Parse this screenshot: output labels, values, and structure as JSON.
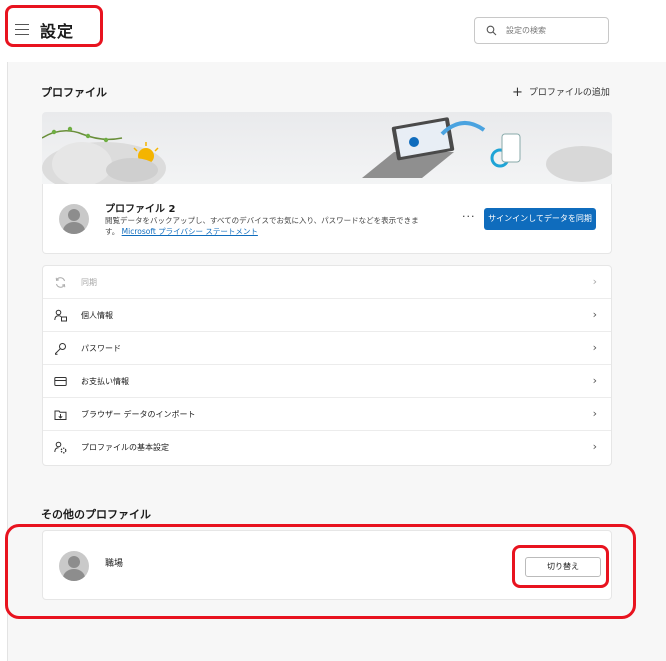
{
  "header": {
    "title": "設定",
    "search_placeholder": "設定の検索"
  },
  "profiles_section": {
    "title": "プロファイル",
    "add_profile_label": "プロファイルの追加",
    "current_profile": {
      "name": "プロファイル 2",
      "description": "閲覧データをバックアップし、すべてのデバイスでお気に入り、パスワードなどを表示できます。",
      "privacy_link": "Microsoft プライバシー ステートメント",
      "more_label": "···",
      "sync_button": "サインインしてデータを同期"
    },
    "settings_items": [
      {
        "label": "同期",
        "icon": "sync-icon",
        "enabled": false
      },
      {
        "label": "個人情報",
        "icon": "person-info-icon",
        "enabled": true
      },
      {
        "label": "パスワード",
        "icon": "key-icon",
        "enabled": true
      },
      {
        "label": "お支払い情報",
        "icon": "credit-card-icon",
        "enabled": true
      },
      {
        "label": "ブラウザー データのインポート",
        "icon": "import-icon",
        "enabled": true
      },
      {
        "label": "プロファイルの基本設定",
        "icon": "profile-settings-icon",
        "enabled": true
      }
    ]
  },
  "other_profiles_section": {
    "title": "その他のプロファイル",
    "profiles": [
      {
        "name": "職場",
        "switch_button": "切り替え"
      }
    ]
  },
  "colors": {
    "accent": "#0f6cbd",
    "highlight": "#e8131f",
    "background": "#f7f7f7"
  }
}
